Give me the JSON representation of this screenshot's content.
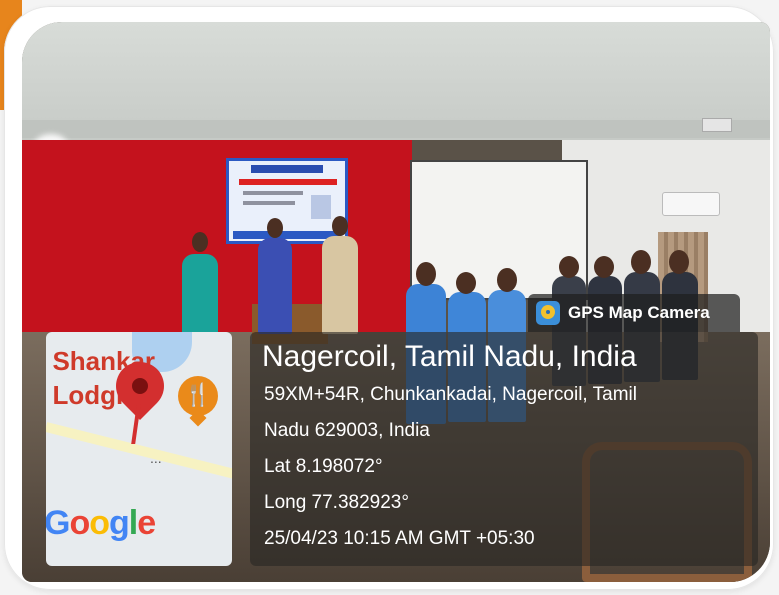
{
  "overlay": {
    "app_badge": {
      "label": "GPS Map Camera",
      "icon": "gps-map-camera-icon"
    },
    "location_title": "Nagercoil, Tamil Nadu, India",
    "address_line1": "59XM+54R, Chunkankadai, Nagercoil, Tamil",
    "address_line2": "Nadu 629003, India",
    "latitude": "Lat 8.198072°",
    "longitude": "Long 77.382923°",
    "timestamp": "25/04/23 10:15 AM GMT +05:30"
  },
  "map_thumbnail": {
    "text_line1": "i Shankar",
    "text_line2": "l Lodging",
    "more": "...",
    "logo": {
      "g1": "G",
      "o1": "o",
      "o2": "o",
      "g2": "g",
      "l": "l",
      "e": "e"
    },
    "pin_icon": "map-pin-icon",
    "poi_icon": "restaurant-icon",
    "colors": {
      "pin": "#d32f2f",
      "poi": "#ea8a1a"
    }
  },
  "colors": {
    "accent": "#e7851c",
    "wall": "#c4121d"
  }
}
